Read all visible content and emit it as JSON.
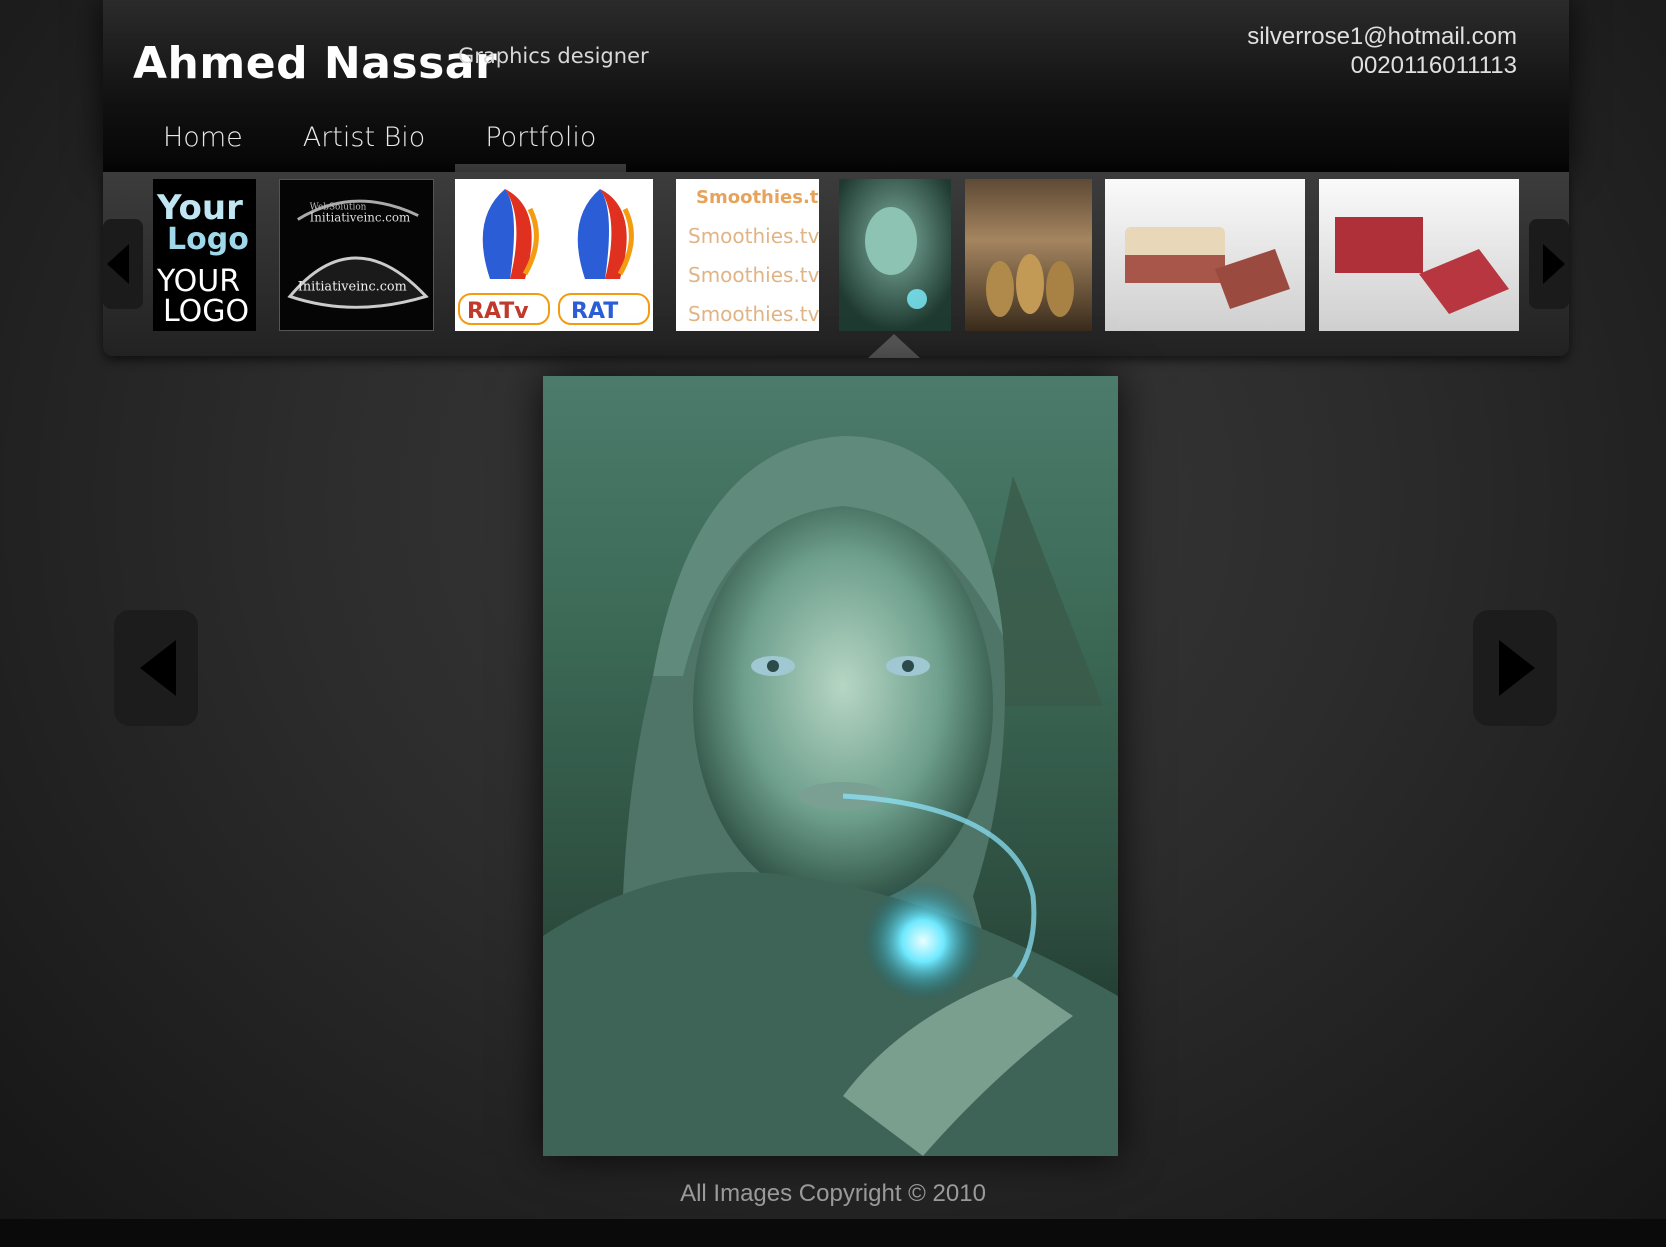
{
  "brand": {
    "name": "Ahmed Nassar",
    "tagline": "Graphics designer"
  },
  "contact": {
    "email": "silverrose1@hotmail.com",
    "phone": "0020116011113"
  },
  "nav": [
    {
      "label": "Home"
    },
    {
      "label": "Artist Bio"
    },
    {
      "label": "Portfolio",
      "active": true
    }
  ],
  "thumbnails": [
    {
      "name": "your-logo",
      "text_top": "Your",
      "text_mid": "Logo",
      "text_bottom": "YOUR LOGO"
    },
    {
      "name": "initiative-inc",
      "tag": "WebSolution",
      "text": "Initiativeinc.com"
    },
    {
      "name": "ratv-logos",
      "text_a": "RATv",
      "text_b": "RAT"
    },
    {
      "name": "smoothies-logos",
      "text": "Smoothies.tv"
    },
    {
      "name": "fantasy-portrait",
      "selected": true
    },
    {
      "name": "wolves-artwork"
    },
    {
      "name": "business-cards-beige"
    },
    {
      "name": "business-cards-red"
    }
  ],
  "main_image": {
    "subject": "fantasy-portrait"
  },
  "footer": {
    "copyright": "All Images Copyright © 2010"
  },
  "colors": {
    "background": "#2c2c2c",
    "header": "#0a0a0a",
    "accent_text": "#e0e0e0"
  },
  "icons": {
    "prev": "triangle-left-icon",
    "next": "triangle-right-icon"
  }
}
